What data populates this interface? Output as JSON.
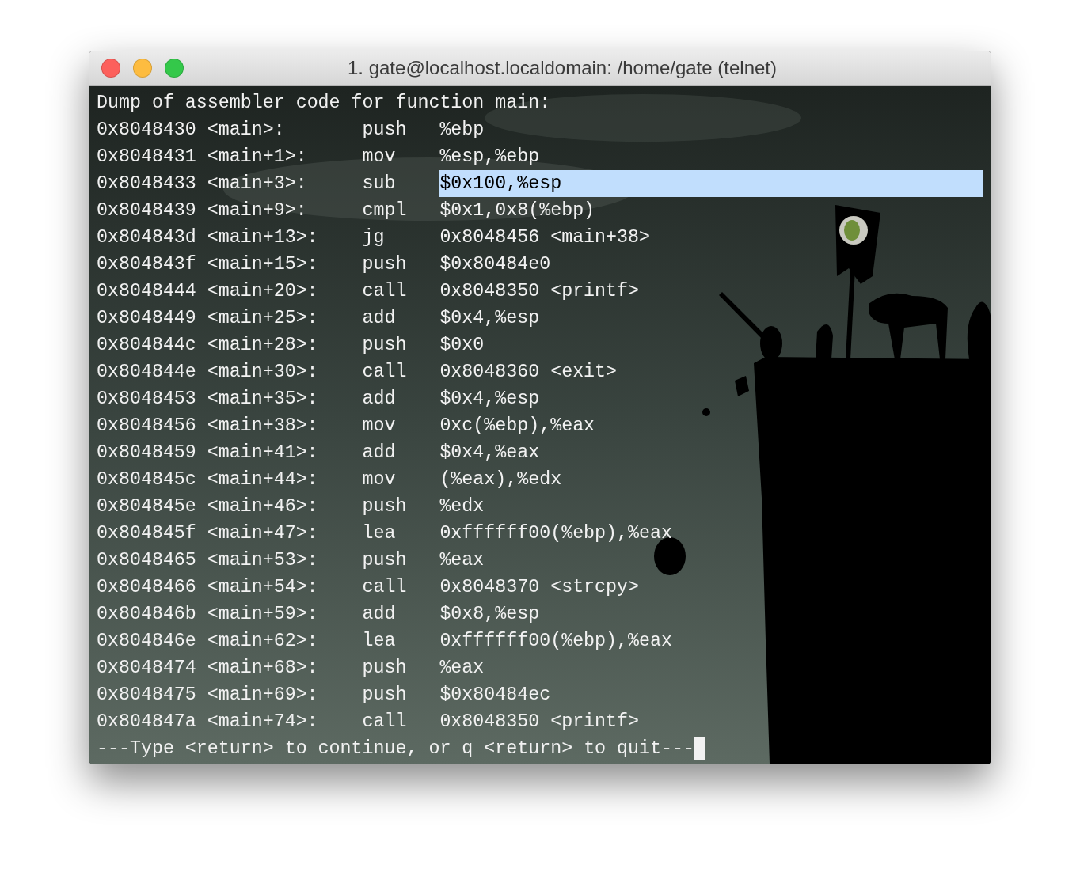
{
  "window": {
    "title": "1. gate@localhost.localdomain: /home/gate (telnet)"
  },
  "header": "Dump of assembler code for function main:",
  "rows": [
    {
      "address": "0x8048430",
      "symbol": "<main>:",
      "instruction": "push",
      "operands": "%ebp",
      "selected": false
    },
    {
      "address": "0x8048431",
      "symbol": "<main+1>:",
      "instruction": "mov",
      "operands": "%esp,%ebp",
      "selected": false
    },
    {
      "address": "0x8048433",
      "symbol": "<main+3>:",
      "instruction": "sub",
      "operands": "$0x100,%esp",
      "selected": true
    },
    {
      "address": "0x8048439",
      "symbol": "<main+9>:",
      "instruction": "cmpl",
      "operands": "$0x1,0x8(%ebp)",
      "selected": false
    },
    {
      "address": "0x804843d",
      "symbol": "<main+13>:",
      "instruction": "jg",
      "operands": "0x8048456 <main+38>",
      "selected": false
    },
    {
      "address": "0x804843f",
      "symbol": "<main+15>:",
      "instruction": "push",
      "operands": "$0x80484e0",
      "selected": false
    },
    {
      "address": "0x8048444",
      "symbol": "<main+20>:",
      "instruction": "call",
      "operands": "0x8048350 <printf>",
      "selected": false
    },
    {
      "address": "0x8048449",
      "symbol": "<main+25>:",
      "instruction": "add",
      "operands": "$0x4,%esp",
      "selected": false
    },
    {
      "address": "0x804844c",
      "symbol": "<main+28>:",
      "instruction": "push",
      "operands": "$0x0",
      "selected": false
    },
    {
      "address": "0x804844e",
      "symbol": "<main+30>:",
      "instruction": "call",
      "operands": "0x8048360 <exit>",
      "selected": false
    },
    {
      "address": "0x8048453",
      "symbol": "<main+35>:",
      "instruction": "add",
      "operands": "$0x4,%esp",
      "selected": false
    },
    {
      "address": "0x8048456",
      "symbol": "<main+38>:",
      "instruction": "mov",
      "operands": "0xc(%ebp),%eax",
      "selected": false
    },
    {
      "address": "0x8048459",
      "symbol": "<main+41>:",
      "instruction": "add",
      "operands": "$0x4,%eax",
      "selected": false
    },
    {
      "address": "0x804845c",
      "symbol": "<main+44>:",
      "instruction": "mov",
      "operands": "(%eax),%edx",
      "selected": false
    },
    {
      "address": "0x804845e",
      "symbol": "<main+46>:",
      "instruction": "push",
      "operands": "%edx",
      "selected": false
    },
    {
      "address": "0x804845f",
      "symbol": "<main+47>:",
      "instruction": "lea",
      "operands": "0xffffff00(%ebp),%eax",
      "selected": false
    },
    {
      "address": "0x8048465",
      "symbol": "<main+53>:",
      "instruction": "push",
      "operands": "%eax",
      "selected": false
    },
    {
      "address": "0x8048466",
      "symbol": "<main+54>:",
      "instruction": "call",
      "operands": "0x8048370 <strcpy>",
      "selected": false
    },
    {
      "address": "0x804846b",
      "symbol": "<main+59>:",
      "instruction": "add",
      "operands": "$0x8,%esp",
      "selected": false
    },
    {
      "address": "0x804846e",
      "symbol": "<main+62>:",
      "instruction": "lea",
      "operands": "0xffffff00(%ebp),%eax",
      "selected": false
    },
    {
      "address": "0x8048474",
      "symbol": "<main+68>:",
      "instruction": "push",
      "operands": "%eax",
      "selected": false
    },
    {
      "address": "0x8048475",
      "symbol": "<main+69>:",
      "instruction": "push",
      "operands": "$0x80484ec",
      "selected": false
    },
    {
      "address": "0x804847a",
      "symbol": "<main+74>:",
      "instruction": "call",
      "operands": "0x8048350 <printf>",
      "selected": false
    }
  ],
  "prompt": {
    "text": "---Type <return> to continue, or q <return> to quit---",
    "cursor": true
  }
}
